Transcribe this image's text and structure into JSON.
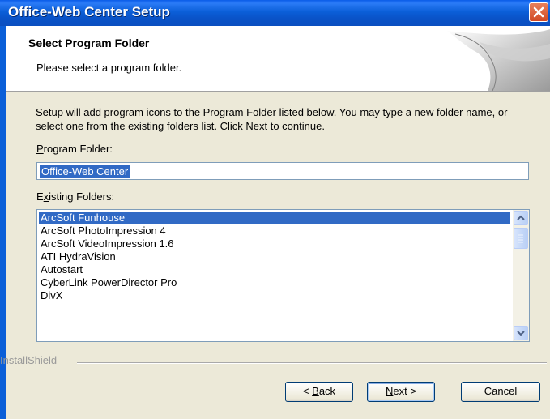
{
  "window": {
    "title": "Office-Web Center Setup"
  },
  "header": {
    "title": "Select Program Folder",
    "subtitle": "Please select a program folder."
  },
  "body": {
    "description": "Setup will add program icons to the Program Folder listed below.  You may type a new folder name, or select one from the existing folders list.  Click Next to continue.",
    "program_folder_label_prefix": "P",
    "program_folder_label_rest": "rogram Folder:",
    "program_folder_value": "Office-Web Center",
    "existing_folders_label_prefix": "E",
    "existing_folders_label_u": "x",
    "existing_folders_label_rest": "isting Folders:",
    "folders": [
      "ArcSoft Funhouse",
      "ArcSoft PhotoImpression 4",
      "ArcSoft VideoImpression 1.6",
      "ATI HydraVision",
      "Autostart",
      "CyberLink PowerDirector Pro",
      "DivX"
    ],
    "selected_folder_index": 0
  },
  "footer": {
    "brand": "InstallShield",
    "back_prefix": "< ",
    "back_u": "B",
    "back_rest": "ack",
    "next_u": "N",
    "next_rest": "ext >",
    "cancel_label": "Cancel"
  },
  "icons": {
    "close": "close-x-icon",
    "scroll_up": "arrow-up-icon",
    "scroll_down": "arrow-down-icon"
  },
  "colors": {
    "titlebar": "#0b5fd8",
    "selection": "#316ac5",
    "close_button": "#d24a24"
  }
}
